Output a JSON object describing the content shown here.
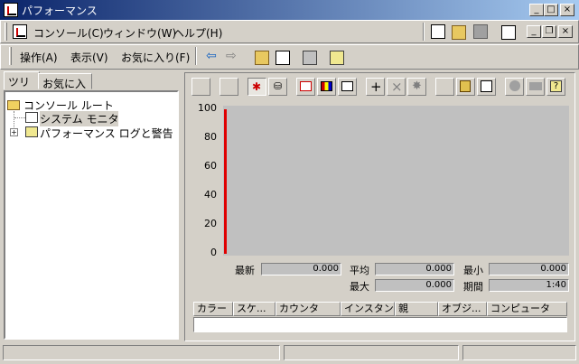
{
  "window": {
    "title": "パフォーマンス"
  },
  "menu": {
    "console": "コンソール(C)",
    "window": "ウィンドウ(W)",
    "help": "ヘルプ(H)"
  },
  "actionbar": {
    "action": "操作(A)",
    "view": "表示(V)",
    "favorites": "お気に入り(F)"
  },
  "tabs": [
    "ツリー",
    "お気に入り"
  ],
  "tree": {
    "root": "コンソール ルート",
    "items": [
      "システム モニタ",
      "パフォーマンス ログと警告"
    ]
  },
  "chart_data": {
    "type": "line",
    "yticks": [
      "100",
      "80",
      "60",
      "40",
      "20",
      "0"
    ],
    "ylim": [
      0,
      100
    ],
    "series": [],
    "grid": false
  },
  "stats": {
    "last_label": "最新",
    "last_value": "0.000",
    "avg_label": "平均",
    "avg_value": "0.000",
    "min_label": "最小",
    "min_value": "0.000",
    "max_label": "最大",
    "max_value": "0.000",
    "duration_label": "期間",
    "duration_value": "1:40"
  },
  "counter_columns": [
    "カラー",
    "スケ...",
    "カウンタ",
    "インスタン...",
    "親",
    "オブジ...",
    "コンピュータ"
  ],
  "colors": {
    "titlebar_start": "#0a246a",
    "titlebar_end": "#a6caf0",
    "time_bar": "#e00000",
    "chart_bg": "#c0c0c0"
  }
}
